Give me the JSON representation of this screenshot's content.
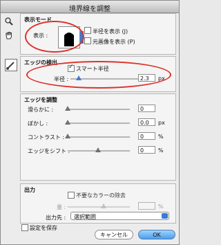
{
  "window": {
    "title": "境界線を調整"
  },
  "tools": {
    "zoom_icon": "zoom-icon",
    "hand_icon": "hand-icon",
    "brush_icon": "brush-icon"
  },
  "view_mode": {
    "title": "表示モード",
    "display_label": "表示 :",
    "show_radius_label": "半径を表示 (J)",
    "show_original_label": "元画像を表示 (P)"
  },
  "edge_detection": {
    "title": "エッジの検出",
    "smart_radius_label": "スマート半径",
    "radius_label": "半径 :",
    "radius_value": "2.3",
    "radius_unit": "px",
    "radius_fraction": 0.12
  },
  "adjust_edge": {
    "title": "エッジを調整",
    "smooth_label": "滑らかに :",
    "smooth_value": "0",
    "feather_label": "ぼかし :",
    "feather_value": "0.0",
    "feather_unit": "px",
    "contrast_label": "コントラスト :",
    "contrast_value": "0",
    "contrast_unit": "%",
    "shift_label": "エッジをシフト :",
    "shift_value": "0",
    "shift_unit": "%"
  },
  "output": {
    "title": "出力",
    "decontaminate_label": "不要なカラーの除去",
    "amount_label": "量 :",
    "amount_unit": "%",
    "output_to_label": "出力先 :",
    "output_to_value": "選択範囲"
  },
  "footer": {
    "remember_label": "設定を保存",
    "cancel_label": "キャンセル",
    "ok_label": "OK"
  }
}
